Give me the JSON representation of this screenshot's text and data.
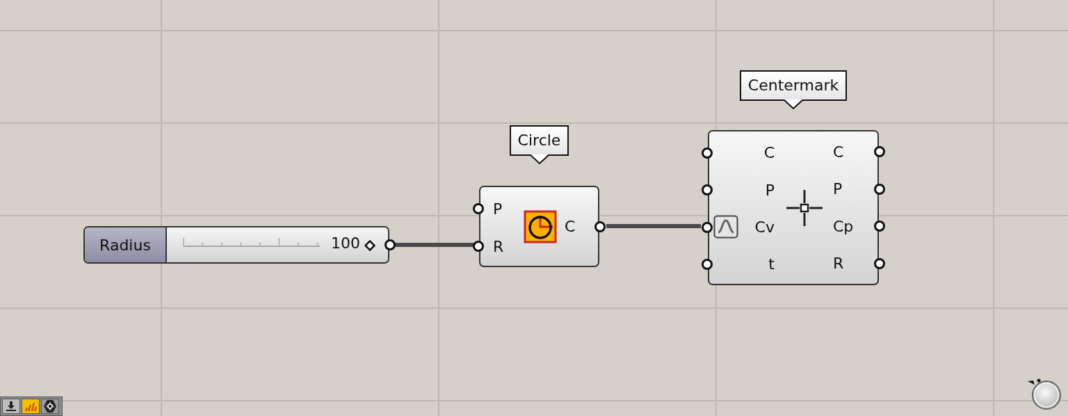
{
  "canvas": {
    "components": [
      {
        "kind": "slider",
        "label": "Radius",
        "value": "100",
        "level": 1
      },
      {
        "kind": "component",
        "tag": "Circle",
        "inputs": [
          {
            "name": "P",
            "reparameterized": false
          },
          {
            "name": "R",
            "reparameterized": false
          }
        ],
        "outputs": [
          "C"
        ]
      },
      {
        "kind": "component",
        "tag": "Centermark",
        "inputs": [
          {
            "name": "C",
            "reparameterized": false
          },
          {
            "name": "P",
            "reparameterized": false
          },
          {
            "name": "Cv",
            "reparameterized": true
          },
          {
            "name": "t",
            "reparameterized": false
          }
        ],
        "outputs": [
          "C",
          "P",
          "Cp",
          "R"
        ]
      }
    ]
  }
}
